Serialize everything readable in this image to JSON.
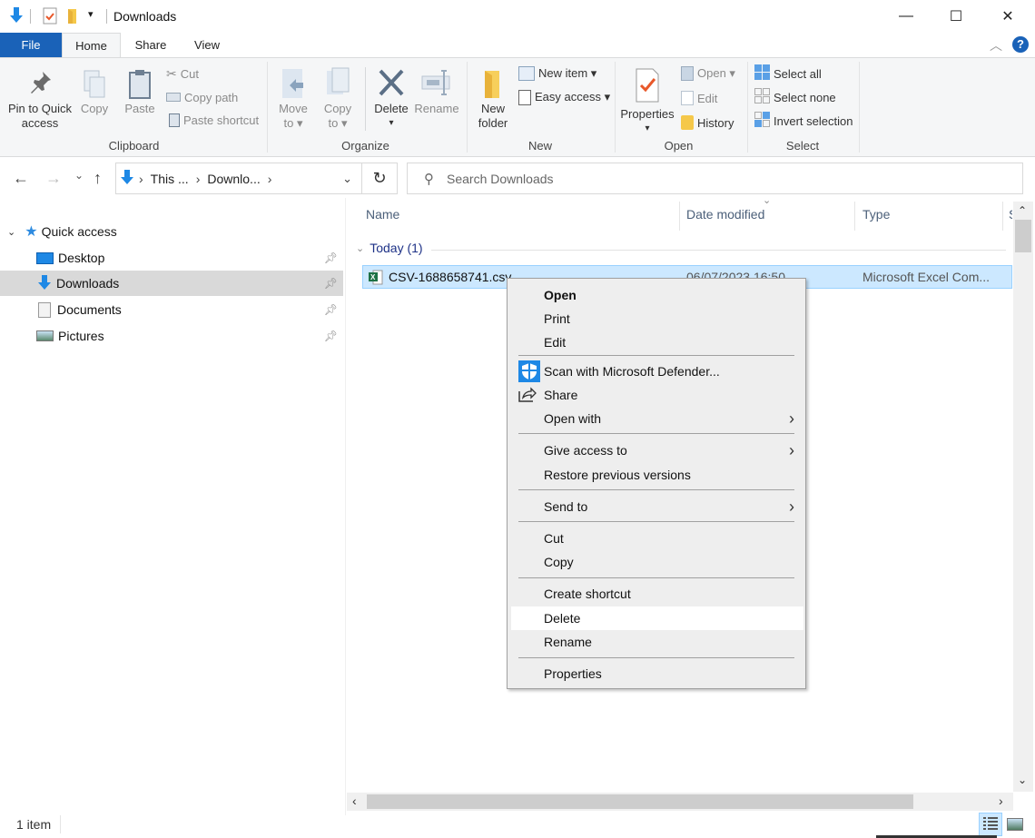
{
  "window": {
    "title": "Downloads",
    "minimize": "—",
    "maximize": "☐",
    "close": "✕"
  },
  "ribbon_tabs": [
    {
      "label": "File"
    },
    {
      "label": "Home"
    },
    {
      "label": "Share"
    },
    {
      "label": "View"
    }
  ],
  "ribbon": {
    "clipboard": {
      "label": "Clipboard",
      "pin": "Pin to Quick access",
      "pin_line1": "Pin to Quick",
      "pin_line2": "access",
      "copy": "Copy",
      "paste": "Paste",
      "cut": "Cut",
      "copy_path": "Copy path",
      "paste_shortcut": "Paste shortcut"
    },
    "organize": {
      "label": "Organize",
      "move_to_1": "Move",
      "move_to_2": "to ▾",
      "copy_to_1": "Copy",
      "copy_to_2": "to ▾",
      "delete": "Delete",
      "delete_arrow": "▾",
      "rename": "Rename"
    },
    "new": {
      "label": "New",
      "new_folder_1": "New",
      "new_folder_2": "folder",
      "new_item": "New item ▾",
      "easy_access": "Easy access ▾"
    },
    "open": {
      "label": "Open",
      "properties": "Properties",
      "properties_arrow": "▾",
      "open": "Open ▾",
      "edit": "Edit",
      "history": "History"
    },
    "select": {
      "label": "Select",
      "select_all": "Select all",
      "select_none": "Select none",
      "invert_selection": "Invert selection"
    }
  },
  "navbar": {
    "back": "←",
    "forward": "→",
    "recent": "⌄",
    "up": "↑",
    "breadcrumb": [
      "This ...",
      "Downlo..."
    ],
    "sep": "›",
    "dropdown": "⌄",
    "refresh": "↻",
    "search_placeholder": "Search Downloads"
  },
  "sidebar": {
    "quick_access": "Quick access",
    "items": [
      {
        "label": "Desktop",
        "pinned": true
      },
      {
        "label": "Downloads",
        "pinned": true,
        "selected": true
      },
      {
        "label": "Documents",
        "pinned": true
      },
      {
        "label": "Pictures",
        "pinned": true
      }
    ]
  },
  "file_list": {
    "columns": [
      "Name",
      "Date modified",
      "Type",
      "S"
    ],
    "sort_column": "Date modified",
    "group": "Today (1)",
    "rows": [
      {
        "name": "CSV-1688658741.csv",
        "date": "06/07/2023 16:50",
        "type": "Microsoft Excel Com...",
        "selected": true
      }
    ]
  },
  "context_menu": {
    "items": [
      {
        "label": "Open",
        "bold": true
      },
      {
        "label": "Print"
      },
      {
        "label": "Edit"
      },
      {
        "label": "Scan with Microsoft Defender...",
        "icon": "defender-shield-icon"
      },
      {
        "label": "Share",
        "icon": "share-icon"
      },
      {
        "label": "Open with",
        "submenu": true
      },
      {
        "label": "Give access to",
        "submenu": true
      },
      {
        "label": "Restore previous versions"
      },
      {
        "label": "Send to",
        "submenu": true
      },
      {
        "label": "Cut"
      },
      {
        "label": "Copy"
      },
      {
        "label": "Create shortcut"
      },
      {
        "label": "Delete",
        "highlighted": true
      },
      {
        "label": "Rename"
      },
      {
        "label": "Properties"
      }
    ],
    "submenu_arrow": "›"
  },
  "status_bar": {
    "item_count": "1 item"
  },
  "colors": {
    "file_tab": "#1a62b8",
    "selection": "#cce8ff",
    "selection_border": "#99d1ff",
    "group_header": "#1e3287",
    "accent_blue": "#1e88e5"
  }
}
